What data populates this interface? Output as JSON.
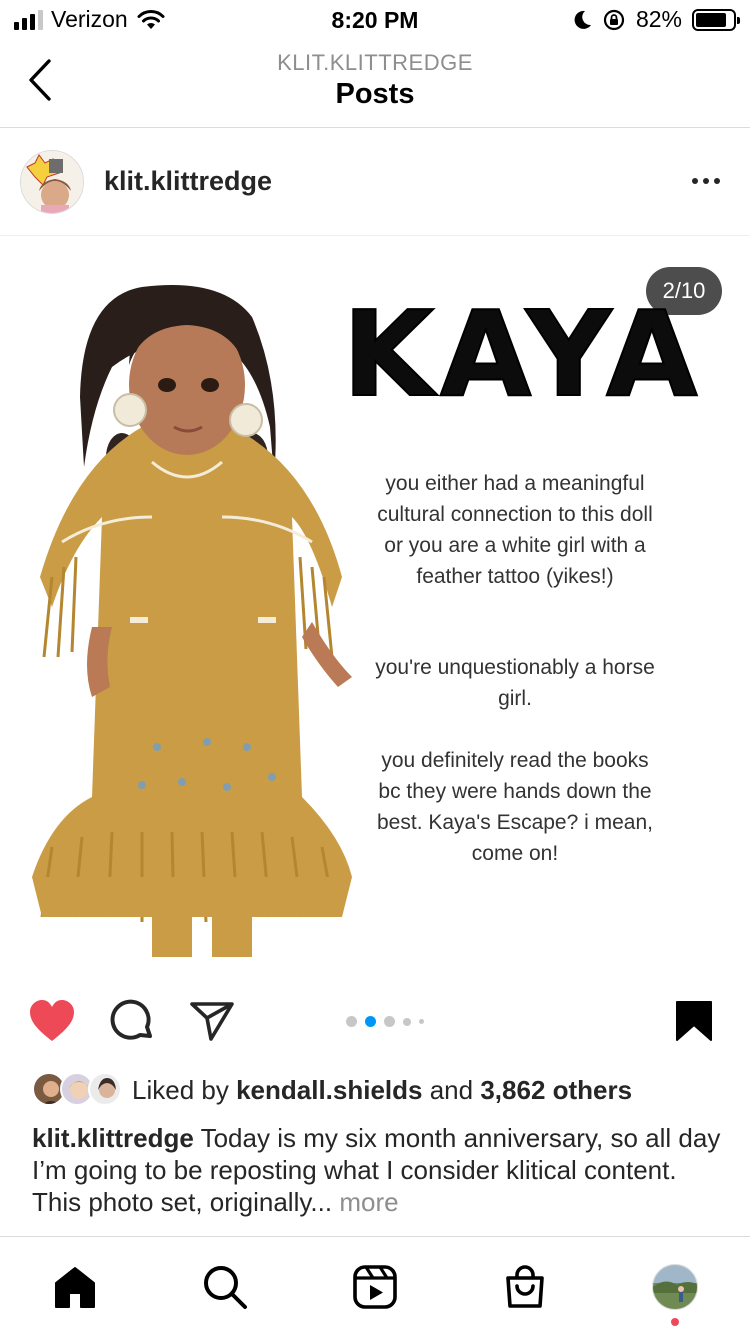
{
  "status_bar": {
    "carrier": "Verizon",
    "time": "8:20 PM",
    "battery": "82%",
    "battery_level": 0.82,
    "icons": [
      "signal-icon",
      "wifi-icon",
      "moon-icon",
      "rotation-lock-icon",
      "battery-icon"
    ]
  },
  "header": {
    "subtitle": "KLIT.KLITTREDGE",
    "title": "Posts",
    "back_icon": "chevron-left-icon"
  },
  "post": {
    "username": "klit.klittredge",
    "more_icon": "more-horizontal-icon",
    "image": {
      "counter": "2/10",
      "title": "KAYA",
      "blurb_1": "you either had a meaningful cultural connection to this doll or you are a white girl with a feather tattoo (yikes!)",
      "blurb_2": "you're unquestionably a horse girl.",
      "blurb_3": "you definitely read the books bc they were hands down the best. Kaya's Escape? i mean, come on!"
    },
    "actions": {
      "liked": true,
      "like_color": "#ed4956",
      "saved": true,
      "carousel_index": 2,
      "carousel_dots_visible": 5
    },
    "likes": {
      "prefix": "Liked by",
      "user": "kendall.shields",
      "conj": "and",
      "count": "3,862 others"
    },
    "caption": {
      "username": "klit.klittredge",
      "text": "Today is my six month anniversary, so all day I’m going to be reposting what I consider klitical content. This photo set, originally...",
      "more": "more"
    }
  },
  "tab_bar": {
    "items": [
      "home-icon",
      "search-icon",
      "reels-icon",
      "shop-icon",
      "profile-avatar"
    ],
    "active": "home-icon",
    "notification_color": "#ed4956"
  }
}
